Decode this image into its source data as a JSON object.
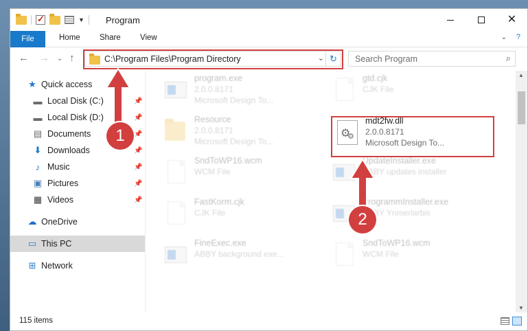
{
  "window": {
    "title": "Program"
  },
  "ribbon": {
    "tabs": [
      "File",
      "Home",
      "Share",
      "View"
    ]
  },
  "navbar": {
    "address": "C:\\Program Files\\Program Directory",
    "search_placeholder": "Search Program"
  },
  "sidebar": {
    "items": [
      {
        "label": "Quick access",
        "icon": "star-icon",
        "pinned": false
      },
      {
        "label": "Local Disk (C:)",
        "icon": "drive-icon",
        "pinned": true
      },
      {
        "label": "Local Disk (D:)",
        "icon": "drive-icon",
        "pinned": true
      },
      {
        "label": "Documents",
        "icon": "documents-icon",
        "pinned": true
      },
      {
        "label": "Downloads",
        "icon": "download-icon",
        "pinned": true
      },
      {
        "label": "Music",
        "icon": "music-icon",
        "pinned": true
      },
      {
        "label": "Pictures",
        "icon": "pictures-icon",
        "pinned": true
      },
      {
        "label": "Videos",
        "icon": "videos-icon",
        "pinned": true
      },
      {
        "label": "OneDrive",
        "icon": "cloud-icon",
        "pinned": false
      },
      {
        "label": "This PC",
        "icon": "computer-icon",
        "pinned": false,
        "selected": true
      },
      {
        "label": "Network",
        "icon": "network-icon",
        "pinned": false
      }
    ]
  },
  "files": [
    {
      "name": "program.exe",
      "line1": "2.0.0.8171",
      "line2": "Microsoft Design To...",
      "icon": "exe-icon",
      "faded": true
    },
    {
      "name": "gtd.cjk",
      "line1": "CJK File",
      "line2": "",
      "icon": "document-icon",
      "faded": true
    },
    {
      "name": "Resource",
      "line1": "2.0.0.8171",
      "line2": "Microsoft Design To...",
      "icon": "folder-icon",
      "faded": true
    },
    {
      "name": "mdt2fw.dll",
      "line1": "2.0.0.8171",
      "line2": "Microsoft Design To...",
      "icon": "dll-gear-icon",
      "faded": false,
      "highlighted": true
    },
    {
      "name": "SndToWP16.wcm",
      "line1": "WCM File",
      "line2": "",
      "icon": "document-icon",
      "faded": true
    },
    {
      "name": "UpdateInstaller.exe",
      "line1": "ABBY updates installer",
      "line2": "",
      "icon": "exe-icon",
      "faded": true
    },
    {
      "name": "FastKorm.cjk",
      "line1": "CJK File",
      "line2": "",
      "icon": "document-icon",
      "faded": true
    },
    {
      "name": "ProgrammInstaller.exe",
      "line1": "ABBY Ynmerlarbis",
      "line2": "",
      "icon": "exe-icon",
      "faded": true
    },
    {
      "name": "FineExec.exe",
      "line1": "ABBY background exe...",
      "line2": "",
      "icon": "exe-icon",
      "faded": true
    },
    {
      "name": "SndToWP16.wcm",
      "line1": "WCM File",
      "line2": "",
      "icon": "document-icon",
      "faded": true
    }
  ],
  "status": {
    "count": "115 items"
  },
  "annotations": {
    "step1": "1",
    "step2": "2",
    "accent": "#d23f3f"
  }
}
